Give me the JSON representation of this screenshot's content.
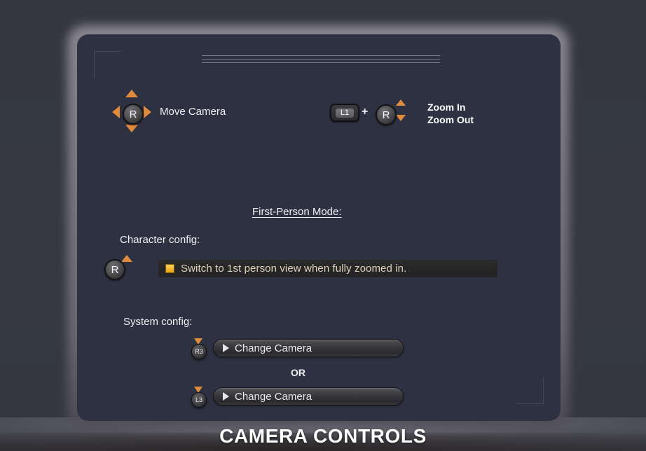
{
  "screen": {
    "title": "CAMERA CONTROLS",
    "panel_bg": "#2d3141",
    "page_bg": "#353841",
    "accent_orange": "#e08b3c",
    "highlight_text": "#ded3bd"
  },
  "bindings": {
    "move": {
      "stick_label": "R",
      "action": "Move Camera"
    },
    "zoom": {
      "shoulder_label": "L1",
      "combiner": "+",
      "stick_label": "R",
      "action_line_1": "Zoom In",
      "action_line_2": "Zoom Out"
    }
  },
  "first_person": {
    "heading": "First-Person Mode:",
    "character_config": {
      "label": "Character config:",
      "stick_label": "R",
      "option_text": "Switch to 1st person view when fully zoomed in.",
      "option_enabled": true
    },
    "system_config": {
      "label": "System config:",
      "entries": [
        {
          "button_label": "R3",
          "action": "Change Camera"
        },
        {
          "button_label": "L3",
          "action": "Change Camera"
        }
      ],
      "separator": "OR"
    }
  }
}
